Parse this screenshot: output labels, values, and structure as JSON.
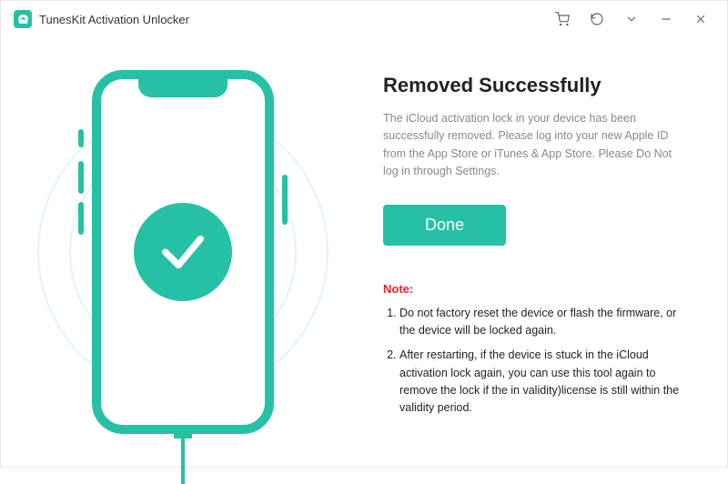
{
  "app": {
    "title": "TunesKit Activation Unlocker"
  },
  "main": {
    "heading": "Removed Successfully",
    "description": "The iCloud activation lock in your device has been successfully removed. Please log into your new Apple ID from the App Store or iTunes & App Store. Please Do Not log in through Settings.",
    "done_label": "Done",
    "note_label": "Note:",
    "notes": [
      "Do not factory reset the device or flash the firmware, or the device will be locked again.",
      "After restarting, if the device is stuck in the iCloud activation lock again, you can use this tool again to remove the lock if the in validity)license is still within the validity period."
    ]
  }
}
